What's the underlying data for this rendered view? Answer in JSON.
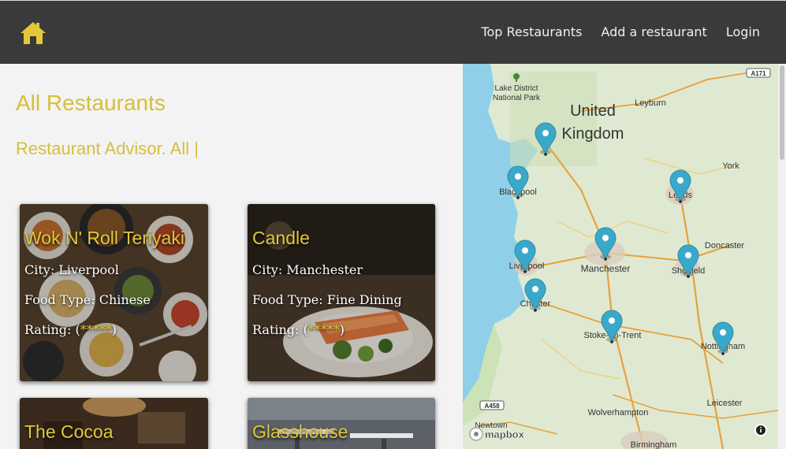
{
  "nav": {
    "home_icon": "home-icon",
    "links": [
      "Top Restaurants",
      "Add a restaurant",
      "Login"
    ]
  },
  "main": {
    "title": "All Restaurants",
    "subtitle": "Restaurant Advisor. All |"
  },
  "restaurants": [
    {
      "name": "Wok N' Roll Teriyaki",
      "city": "City: Liverpool",
      "food": "Food Type: Chinese",
      "rating_prefix": "Rating: (",
      "stars": "*****",
      "rating_suffix": ")"
    },
    {
      "name": "Candle",
      "city": "City: Manchester",
      "food": "Food Type: Fine Dining",
      "rating_prefix": "Rating: (",
      "stars": "*****",
      "rating_suffix": ")"
    },
    {
      "name": "The Cocoa",
      "city": "",
      "food": "",
      "rating_prefix": "",
      "stars": "",
      "rating_suffix": ""
    },
    {
      "name": "Glasshouse",
      "city": "",
      "food": "",
      "rating_prefix": "",
      "stars": "",
      "rating_suffix": ""
    }
  ],
  "map": {
    "country": [
      "United",
      "Kingdom"
    ],
    "park": [
      "Lake District",
      "National Park"
    ],
    "cities": [
      "Leyburn",
      "York",
      "Leeds",
      "Blackpool",
      "Doncaster",
      "Manchester",
      "Liverpool",
      "Sheffield",
      "Chester",
      "Stoke-on-Trent",
      "Nottingham",
      "Wolverhampton",
      "Leicester",
      "Newtown",
      "Birmingham"
    ],
    "roads": [
      "A171",
      "A458"
    ],
    "attribution": "mapbox",
    "info_icon": "info-icon",
    "marker_count": 9
  },
  "colors": {
    "accent": "#d6bf3a",
    "navbar": "#3a3a3a",
    "marker": "#3aa9c9"
  }
}
